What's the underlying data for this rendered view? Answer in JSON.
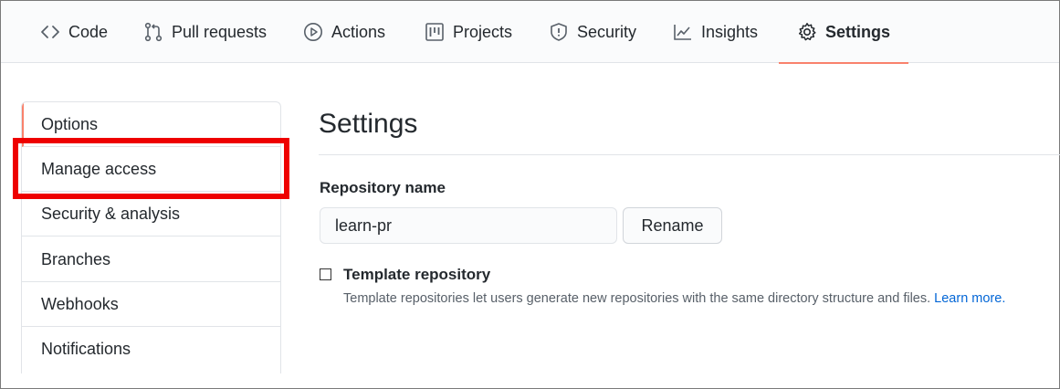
{
  "tabs": [
    {
      "label": "Code",
      "icon": "code-icon"
    },
    {
      "label": "Pull requests",
      "icon": "pull-request-icon"
    },
    {
      "label": "Actions",
      "icon": "play-icon"
    },
    {
      "label": "Projects",
      "icon": "project-icon"
    },
    {
      "label": "Security",
      "icon": "shield-icon"
    },
    {
      "label": "Insights",
      "icon": "graph-icon"
    },
    {
      "label": "Settings",
      "icon": "gear-icon",
      "selected": true
    }
  ],
  "sidebar": {
    "items": [
      {
        "label": "Options",
        "selected": true
      },
      {
        "label": "Manage access",
        "highlighted": true
      },
      {
        "label": "Security & analysis"
      },
      {
        "label": "Branches"
      },
      {
        "label": "Webhooks"
      },
      {
        "label": "Notifications"
      }
    ]
  },
  "main": {
    "title": "Settings",
    "repo_name_label": "Repository name",
    "repo_name_value": "learn-pr",
    "rename_label": "Rename",
    "template_label": "Template repository",
    "template_checked": false,
    "template_desc": "Template repositories let users generate new repositories with the same directory structure and files.",
    "learn_more": "Learn more."
  },
  "colors": {
    "accent_underline": "#f9826c",
    "highlight_box": "#ee0000",
    "link": "#0366d6"
  }
}
